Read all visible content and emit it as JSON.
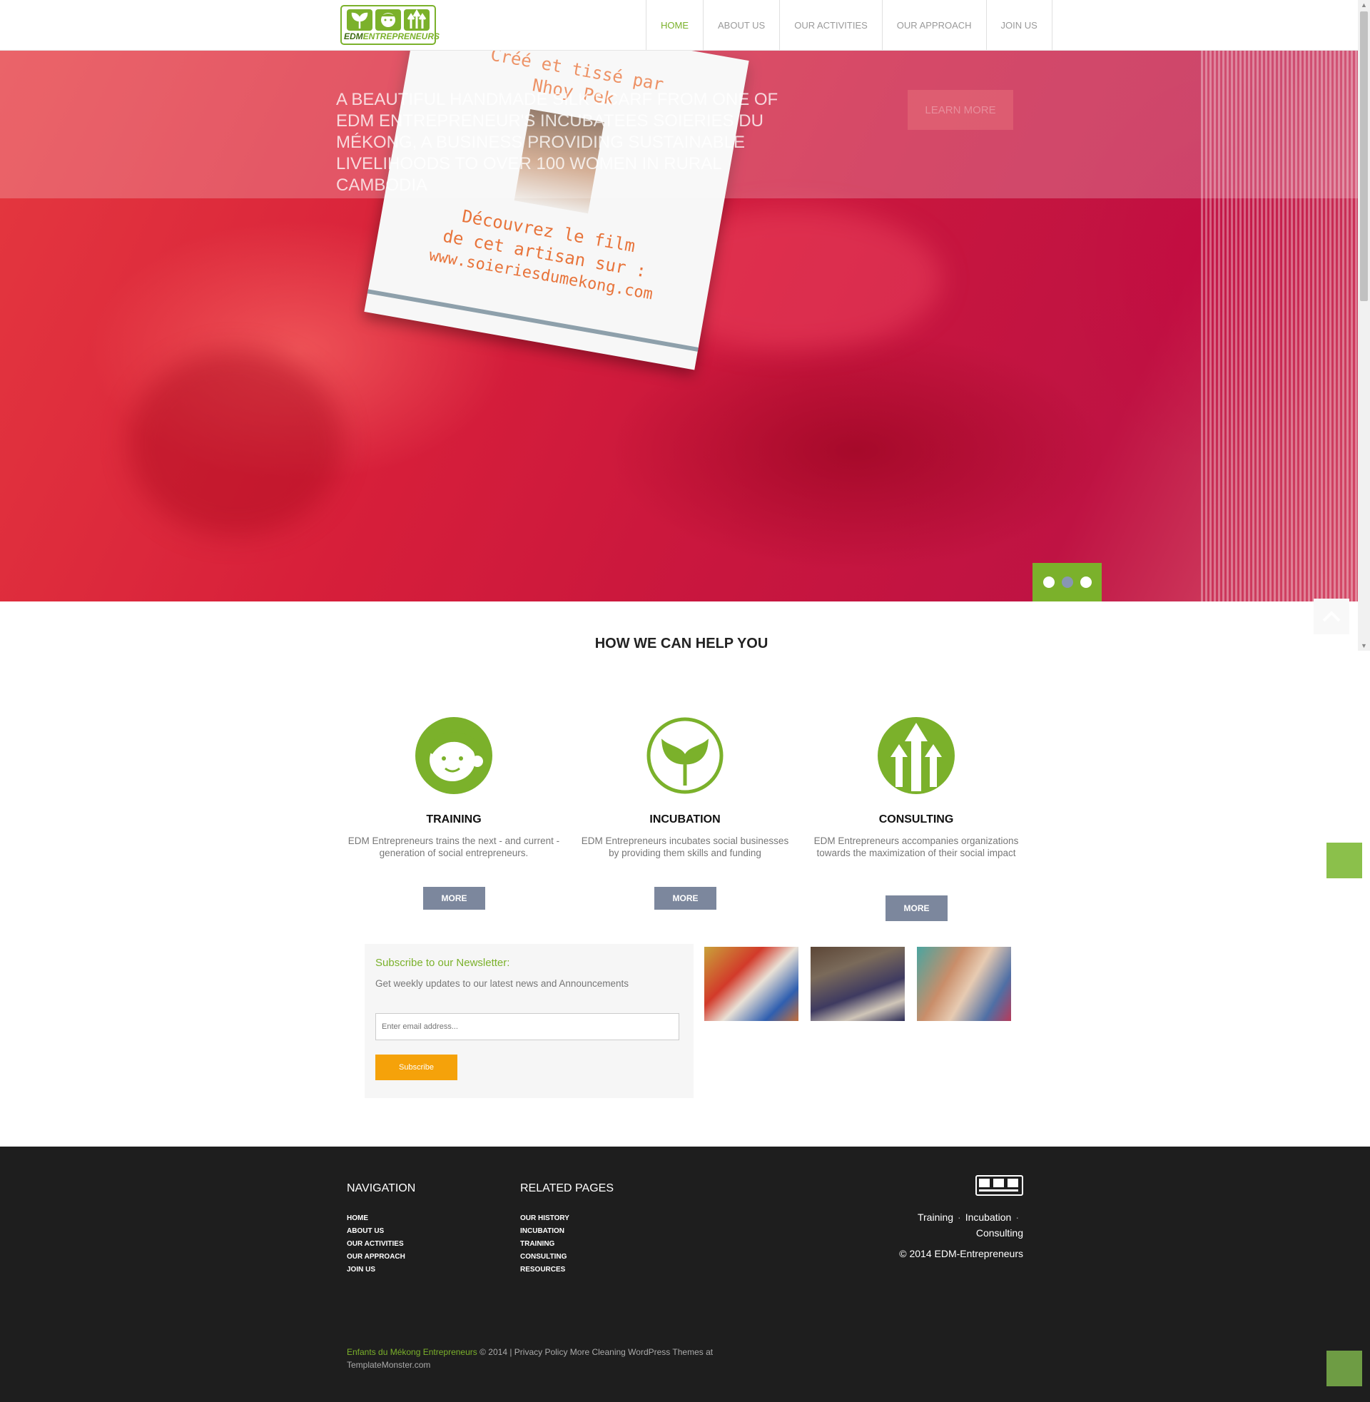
{
  "header": {
    "logo_text_a": "EDM",
    "logo_text_b": "ENTREPRENEURS",
    "nav": [
      "HOME",
      "ABOUT US",
      "OUR ACTIVITIES",
      "OUR APPROACH",
      "JOIN US"
    ],
    "active_nav": "HOME"
  },
  "hero": {
    "tag_lines": [
      "Créé et tissé par",
      "Nhoy Pek",
      "Découvrez le film",
      "de cet artisan sur :",
      "www.soieriesdumekong.com"
    ],
    "caption": "A beautiful handmade silk scarf from one of EDM Entrepreneur's incubatees Soieries du Mékong, a business providing sustainable livelihoods to over 100 women in rural Cambodia",
    "learn_more": "LEARN MORE",
    "slides": 3,
    "current_slide": 2
  },
  "section": {
    "title": "HOW WE CAN HELP YOU"
  },
  "services": [
    {
      "name": "TRAINING",
      "desc": "EDM Entrepreneurs trains the next - and current - generation of social entrepreneurs.",
      "button": "MORE",
      "icon": "face-icon"
    },
    {
      "name": "INCUBATION",
      "desc": "EDM Entrepreneurs incubates social businesses by providing them skills and funding",
      "button": "MORE",
      "icon": "sprout-icon"
    },
    {
      "name": "CONSULTING",
      "desc": "EDM Entrepreneurs accompanies organizations towards the maximization of their social impact",
      "button": "MORE",
      "icon": "arrows-up-icon"
    }
  ],
  "newsletter": {
    "title": "Subscribe to our Newsletter:",
    "text": "Get weekly updates to our latest news and Announcements",
    "placeholder": "Enter email address...",
    "button": "Subscribe"
  },
  "footer": {
    "nav_title": "NAVIGATION",
    "nav_items": [
      "HOME",
      "ABOUT US",
      "OUR ACTIVITIES",
      "OUR APPROACH",
      "JOIN US"
    ],
    "related_title": "RELATED PAGES",
    "related_items": [
      "OUR HISTORY",
      "INCUBATION",
      "TRAINING",
      "CONSULTING",
      "RESOURCES"
    ],
    "services": [
      "Training",
      "Incubation",
      "Consulting"
    ],
    "copyright": "© 2014 EDM-Entrepreneurs",
    "bottom_brand": "Enfants du Mékong Entrepreneurs",
    "bottom_text": "© 2014 | Privacy Policy More Cleaning WordPress Themes at TemplateMonster.com"
  },
  "colors": {
    "brand_green": "#7bb12b",
    "button_gray": "#7c879d",
    "subscribe_orange": "#f5a20a",
    "footer_bg": "#1e1e1e"
  }
}
